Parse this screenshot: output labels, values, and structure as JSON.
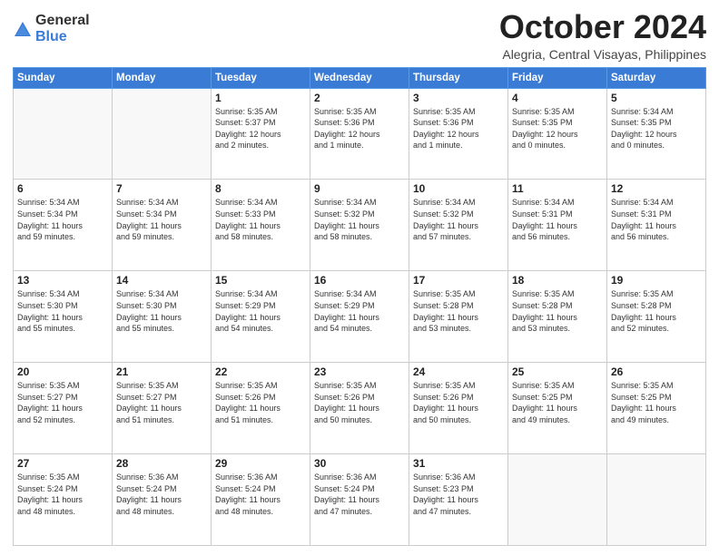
{
  "logo": {
    "general": "General",
    "blue": "Blue"
  },
  "title": "October 2024",
  "subtitle": "Alegria, Central Visayas, Philippines",
  "days": [
    "Sunday",
    "Monday",
    "Tuesday",
    "Wednesday",
    "Thursday",
    "Friday",
    "Saturday"
  ],
  "weeks": [
    [
      {
        "day": "",
        "content": ""
      },
      {
        "day": "",
        "content": ""
      },
      {
        "day": "1",
        "content": "Sunrise: 5:35 AM\nSunset: 5:37 PM\nDaylight: 12 hours\nand 2 minutes."
      },
      {
        "day": "2",
        "content": "Sunrise: 5:35 AM\nSunset: 5:36 PM\nDaylight: 12 hours\nand 1 minute."
      },
      {
        "day": "3",
        "content": "Sunrise: 5:35 AM\nSunset: 5:36 PM\nDaylight: 12 hours\nand 1 minute."
      },
      {
        "day": "4",
        "content": "Sunrise: 5:35 AM\nSunset: 5:35 PM\nDaylight: 12 hours\nand 0 minutes."
      },
      {
        "day": "5",
        "content": "Sunrise: 5:34 AM\nSunset: 5:35 PM\nDaylight: 12 hours\nand 0 minutes."
      }
    ],
    [
      {
        "day": "6",
        "content": "Sunrise: 5:34 AM\nSunset: 5:34 PM\nDaylight: 11 hours\nand 59 minutes."
      },
      {
        "day": "7",
        "content": "Sunrise: 5:34 AM\nSunset: 5:34 PM\nDaylight: 11 hours\nand 59 minutes."
      },
      {
        "day": "8",
        "content": "Sunrise: 5:34 AM\nSunset: 5:33 PM\nDaylight: 11 hours\nand 58 minutes."
      },
      {
        "day": "9",
        "content": "Sunrise: 5:34 AM\nSunset: 5:32 PM\nDaylight: 11 hours\nand 58 minutes."
      },
      {
        "day": "10",
        "content": "Sunrise: 5:34 AM\nSunset: 5:32 PM\nDaylight: 11 hours\nand 57 minutes."
      },
      {
        "day": "11",
        "content": "Sunrise: 5:34 AM\nSunset: 5:31 PM\nDaylight: 11 hours\nand 56 minutes."
      },
      {
        "day": "12",
        "content": "Sunrise: 5:34 AM\nSunset: 5:31 PM\nDaylight: 11 hours\nand 56 minutes."
      }
    ],
    [
      {
        "day": "13",
        "content": "Sunrise: 5:34 AM\nSunset: 5:30 PM\nDaylight: 11 hours\nand 55 minutes."
      },
      {
        "day": "14",
        "content": "Sunrise: 5:34 AM\nSunset: 5:30 PM\nDaylight: 11 hours\nand 55 minutes."
      },
      {
        "day": "15",
        "content": "Sunrise: 5:34 AM\nSunset: 5:29 PM\nDaylight: 11 hours\nand 54 minutes."
      },
      {
        "day": "16",
        "content": "Sunrise: 5:34 AM\nSunset: 5:29 PM\nDaylight: 11 hours\nand 54 minutes."
      },
      {
        "day": "17",
        "content": "Sunrise: 5:35 AM\nSunset: 5:28 PM\nDaylight: 11 hours\nand 53 minutes."
      },
      {
        "day": "18",
        "content": "Sunrise: 5:35 AM\nSunset: 5:28 PM\nDaylight: 11 hours\nand 53 minutes."
      },
      {
        "day": "19",
        "content": "Sunrise: 5:35 AM\nSunset: 5:28 PM\nDaylight: 11 hours\nand 52 minutes."
      }
    ],
    [
      {
        "day": "20",
        "content": "Sunrise: 5:35 AM\nSunset: 5:27 PM\nDaylight: 11 hours\nand 52 minutes."
      },
      {
        "day": "21",
        "content": "Sunrise: 5:35 AM\nSunset: 5:27 PM\nDaylight: 11 hours\nand 51 minutes."
      },
      {
        "day": "22",
        "content": "Sunrise: 5:35 AM\nSunset: 5:26 PM\nDaylight: 11 hours\nand 51 minutes."
      },
      {
        "day": "23",
        "content": "Sunrise: 5:35 AM\nSunset: 5:26 PM\nDaylight: 11 hours\nand 50 minutes."
      },
      {
        "day": "24",
        "content": "Sunrise: 5:35 AM\nSunset: 5:26 PM\nDaylight: 11 hours\nand 50 minutes."
      },
      {
        "day": "25",
        "content": "Sunrise: 5:35 AM\nSunset: 5:25 PM\nDaylight: 11 hours\nand 49 minutes."
      },
      {
        "day": "26",
        "content": "Sunrise: 5:35 AM\nSunset: 5:25 PM\nDaylight: 11 hours\nand 49 minutes."
      }
    ],
    [
      {
        "day": "27",
        "content": "Sunrise: 5:35 AM\nSunset: 5:24 PM\nDaylight: 11 hours\nand 48 minutes."
      },
      {
        "day": "28",
        "content": "Sunrise: 5:36 AM\nSunset: 5:24 PM\nDaylight: 11 hours\nand 48 minutes."
      },
      {
        "day": "29",
        "content": "Sunrise: 5:36 AM\nSunset: 5:24 PM\nDaylight: 11 hours\nand 48 minutes."
      },
      {
        "day": "30",
        "content": "Sunrise: 5:36 AM\nSunset: 5:24 PM\nDaylight: 11 hours\nand 47 minutes."
      },
      {
        "day": "31",
        "content": "Sunrise: 5:36 AM\nSunset: 5:23 PM\nDaylight: 11 hours\nand 47 minutes."
      },
      {
        "day": "",
        "content": ""
      },
      {
        "day": "",
        "content": ""
      }
    ]
  ]
}
